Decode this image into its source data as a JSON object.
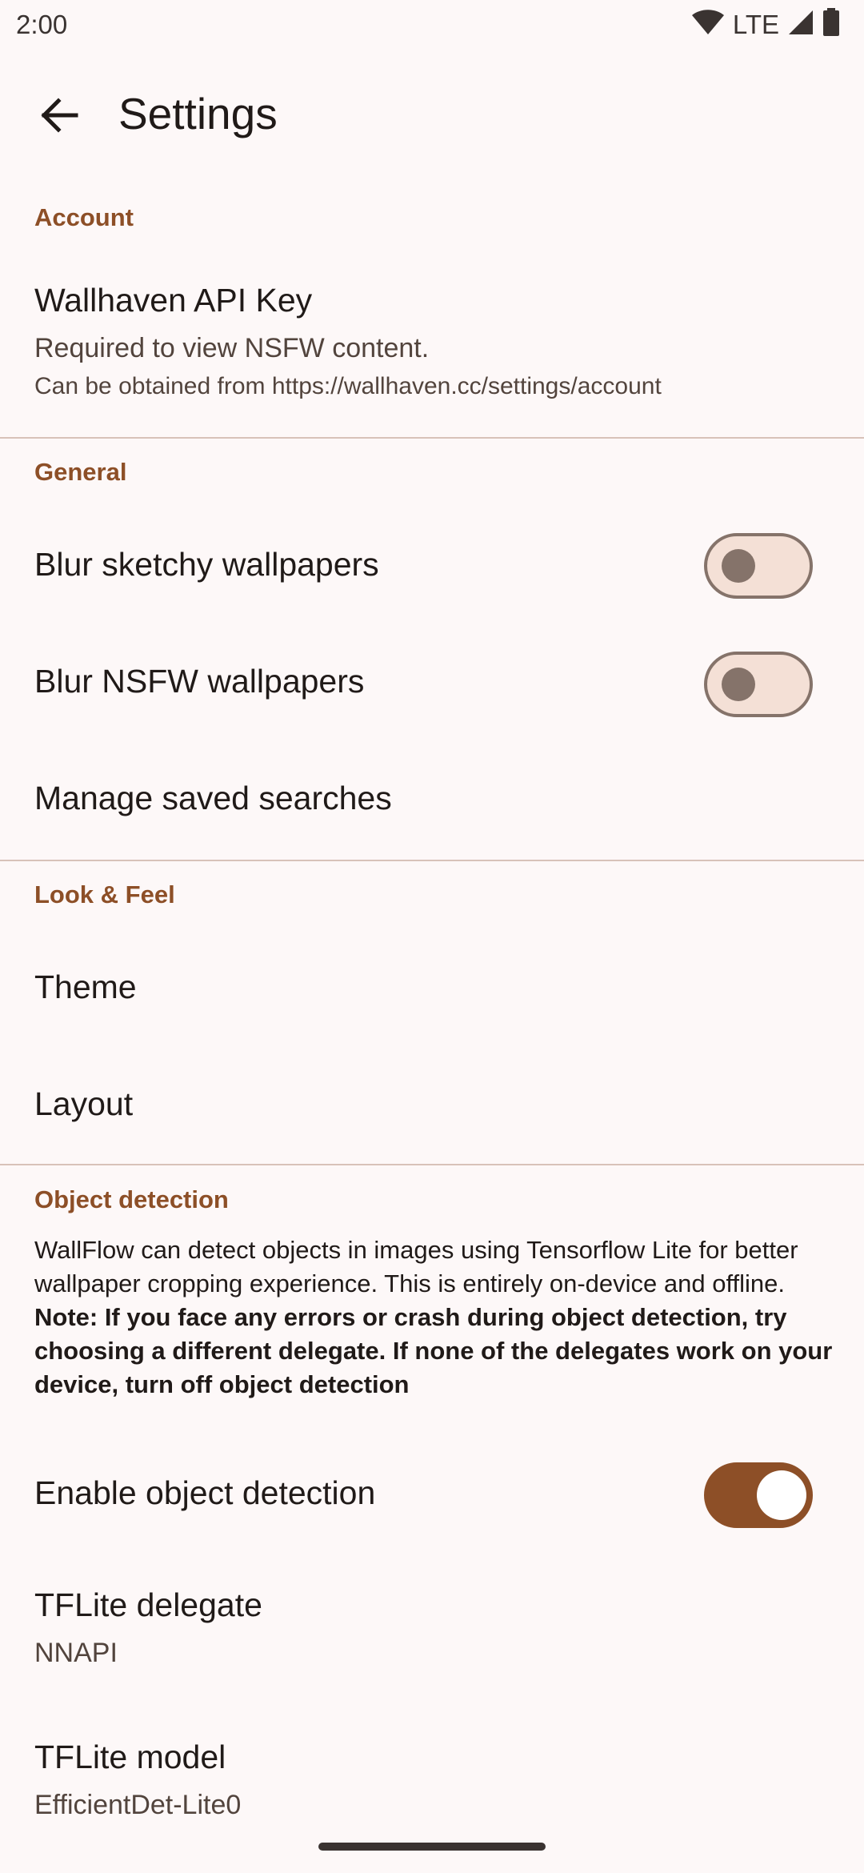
{
  "status_bar": {
    "time": "2:00",
    "network": "LTE",
    "icons": [
      "wifi-icon",
      "signal-icon",
      "battery-icon"
    ]
  },
  "app_bar": {
    "title": "Settings",
    "back_icon": "arrow-back-icon"
  },
  "colors": {
    "accent": "#8d4f27",
    "background": "#fdf8f8",
    "divider": "#d8c2b9",
    "switch_off_track": "#f4e0d6",
    "switch_off_outline": "#85736a"
  },
  "sections": {
    "account": {
      "header": "Account",
      "api_key": {
        "title": "Wallhaven API Key",
        "summary": "Required to view NSFW content.",
        "hint": "Can be obtained from https://wallhaven.cc/settings/account"
      }
    },
    "general": {
      "header": "General",
      "blur_sketchy": {
        "title": "Blur sketchy wallpapers",
        "enabled": false
      },
      "blur_nsfw": {
        "title": "Blur NSFW wallpapers",
        "enabled": false
      },
      "saved_searches": {
        "title": "Manage saved searches"
      }
    },
    "look_feel": {
      "header": "Look & Feel",
      "theme": {
        "title": "Theme"
      },
      "layout": {
        "title": "Layout"
      }
    },
    "object_detection": {
      "header": "Object detection",
      "description": "WallFlow can detect objects in images using Tensorflow Lite for better wallpaper cropping experience. This is entirely on-device and offline.",
      "note": "Note: If you face any errors or crash during object detection, try choosing a different delegate. If none of the delegates work on your device, turn off object detection",
      "enable": {
        "title": "Enable object detection",
        "enabled": true
      },
      "delegate": {
        "title": "TFLite delegate",
        "value": "NNAPI"
      },
      "model": {
        "title": "TFLite model",
        "value": "EfficientDet-Lite0"
      }
    }
  }
}
